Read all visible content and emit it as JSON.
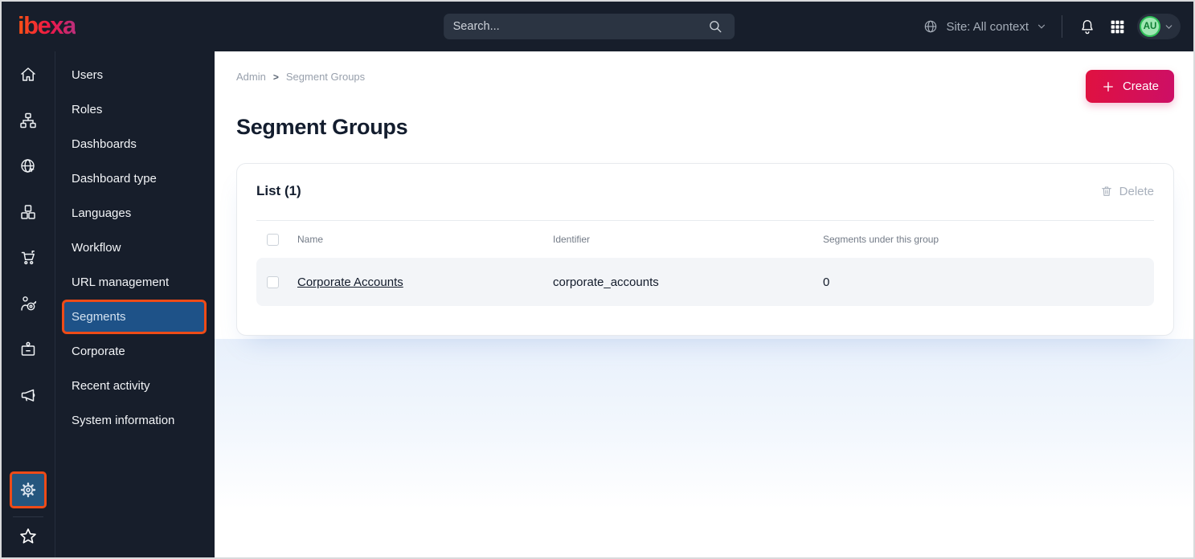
{
  "topbar": {
    "logo_text": "ibexa",
    "search_placeholder": "Search...",
    "site_context_label": "Site: All context",
    "avatar_initials": "AU"
  },
  "sidebar": {
    "icons": [
      "home",
      "site-structure",
      "site",
      "product-catalog",
      "commerce",
      "personalization",
      "corporate",
      "campaign",
      "admin-settings",
      "bookmarks"
    ],
    "active_icon": "admin-settings"
  },
  "admin_menu": {
    "items": [
      "Users",
      "Roles",
      "Dashboards",
      "Dashboard type",
      "Languages",
      "Workflow",
      "URL management",
      "Segments",
      "Corporate",
      "Recent activity",
      "System information"
    ],
    "active_item": "Segments"
  },
  "main": {
    "breadcrumb": {
      "items": [
        "Admin",
        "Segment Groups"
      ],
      "separator": ">"
    },
    "title": "Segment Groups",
    "create_button_label": "Create",
    "list_card": {
      "title": "List (1)",
      "delete_button_label": "Delete",
      "columns": [
        "Name",
        "Identifier",
        "Segments under this group"
      ],
      "rows": [
        {
          "name": "Corporate Accounts",
          "identifier": "corporate_accounts",
          "segments_under_group": "0"
        }
      ]
    }
  },
  "colors": {
    "topbar_bg": "#171e2b",
    "accent_orange": "#ee4b17",
    "active_blue": "#1e5288",
    "button_gradient_start": "#e01140",
    "button_gradient_end": "#cd0f66",
    "logo_gradient_start": "#fb4d17",
    "logo_gradient_end": "#bf2d78",
    "avatar_green": "#9fe7b3",
    "page_glow_blue": "#e8f0fb"
  }
}
